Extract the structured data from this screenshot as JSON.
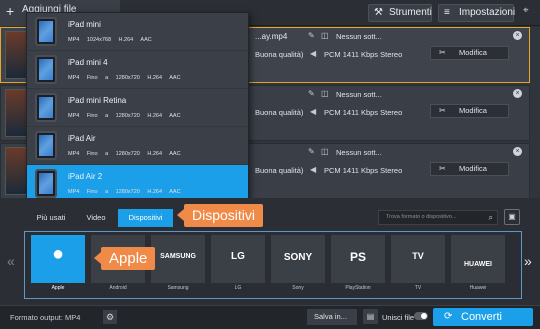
{
  "toolbar": {
    "add_label": "Aggiungi file",
    "tools_label": "Strumenti",
    "settings_label": "Impostazioni"
  },
  "rows": [
    {
      "filename": "...ay.mp4",
      "subtitles": "Nessun sott...",
      "quality": "Buona qualità)",
      "audio": "PCM 1411 Kbps Stereo",
      "edit": "Modifica"
    },
    {
      "filename": "",
      "subtitles": "Nessun sott...",
      "quality": "Buona qualità)",
      "audio": "PCM 1411 Kbps Stereo",
      "edit": "Modifica"
    },
    {
      "filename": "",
      "subtitles": "Nessun sott...",
      "quality": "Buona qualità)",
      "audio": "PCM 1411 Kbps Stereo",
      "edit": "Modifica"
    }
  ],
  "dropdown": [
    {
      "name": "iPad mini",
      "spec": "MP4 1024x768 H.264 AAC"
    },
    {
      "name": "iPad mini 4",
      "spec": "MP4 Fino a 1280x720 H.264 AAC"
    },
    {
      "name": "iPad mini Retina",
      "spec": "MP4 Fino a 1280x720 H.264 AAC"
    },
    {
      "name": "iPad Air",
      "spec": "MP4 Fino a 1280x720 H.264 AAC"
    },
    {
      "name": "iPad Air 2",
      "spec": "MP4 Fino a 1280x720 H.264 AAC",
      "selected": true
    }
  ],
  "tabs": {
    "popular": "Più usati",
    "video": "Video",
    "devices": "Dispositivi"
  },
  "callouts": {
    "devices": "Dispositivi",
    "apple": "Apple"
  },
  "search": {
    "placeholder": "Trova formato o dispositivo..."
  },
  "devices": [
    {
      "label": "Apple",
      "logo": ""
    },
    {
      "label": "Android",
      "logo": ""
    },
    {
      "label": "Samsung",
      "logo": "SAMSUNG"
    },
    {
      "label": "LG",
      "logo": "LG"
    },
    {
      "label": "Sony",
      "logo": "SONY"
    },
    {
      "label": "PlayStation",
      "logo": "PS"
    },
    {
      "label": "TV",
      "logo": "TV"
    },
    {
      "label": "Huawei",
      "logo": "HUAWEI"
    }
  ],
  "bottom": {
    "format_output": "Formato output: MP4",
    "save": "Salva in...",
    "merge": "Unisci file",
    "convert": "Converti"
  },
  "colors": {
    "accent": "#1a9fe8",
    "callout": "#f08a48",
    "selected_border": "#e8a52b"
  }
}
